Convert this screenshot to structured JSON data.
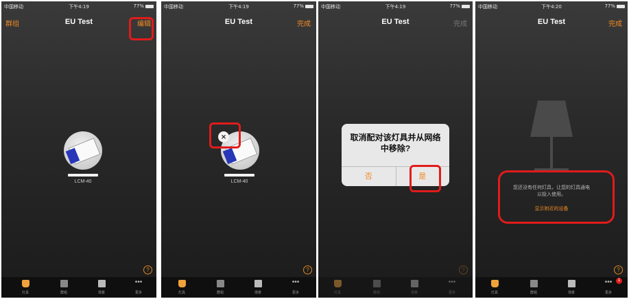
{
  "screens": [
    {
      "status": {
        "carrier": "中国移动",
        "time": "下午4:19",
        "battery": "77%"
      },
      "nav": {
        "left": "群组",
        "title": "EU Test",
        "right": "编辑"
      },
      "device_label": "LCM-40",
      "tabs": [
        "灯具",
        "群组",
        "场景",
        "更多"
      ]
    },
    {
      "status": {
        "carrier": "中国移动",
        "time": "下午4:19",
        "battery": "77%"
      },
      "nav": {
        "title": "EU Test",
        "right": "完成"
      },
      "remove_glyph": "×",
      "device_label": "LCM-40",
      "tabs": [
        "灯具",
        "群组",
        "场景",
        "更多"
      ]
    },
    {
      "status": {
        "carrier": "中国移动",
        "time": "下午4:19",
        "battery": "77%"
      },
      "nav": {
        "title": "EU Test",
        "right": "完成"
      },
      "dialog": {
        "message_line1": "取消配对该灯具并从网络",
        "message_line2": "中移除?",
        "no": "否",
        "yes": "是"
      },
      "tabs": [
        "灯具",
        "群组",
        "场景",
        "更多"
      ]
    },
    {
      "status": {
        "carrier": "中国移动",
        "time": "下午4:20",
        "battery": "77%"
      },
      "nav": {
        "title": "EU Test",
        "right": "完成"
      },
      "empty_line1": "您还没有任何灯具，让您的灯具通电",
      "empty_line2": "以投入使用。",
      "nearby_link": "显示附近的设备",
      "badge": "1",
      "tabs": [
        "灯具",
        "群组",
        "场景",
        "更多"
      ]
    }
  ],
  "help_glyph": "?",
  "colors": {
    "accent": "#f08a24",
    "highlight": "#e21b1b",
    "background": "#2a2a2a"
  }
}
